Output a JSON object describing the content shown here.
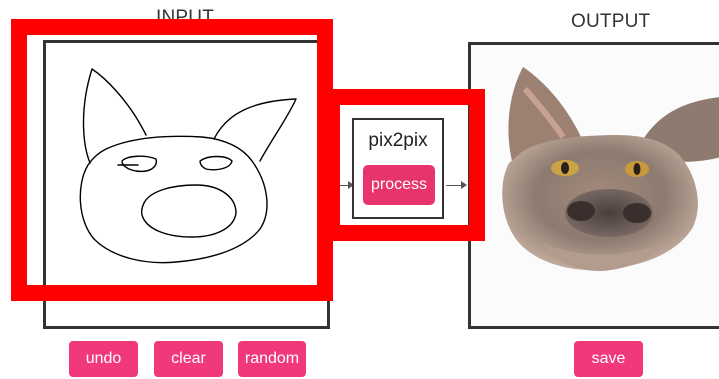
{
  "input": {
    "title": "INPUT",
    "canvas_icon": "pig-sketch-drawing",
    "buttons": {
      "undo": "undo",
      "clear": "clear",
      "random": "random"
    }
  },
  "model": {
    "name": "pix2pix",
    "process_label": "process"
  },
  "output": {
    "title": "OUTPUT",
    "image_icon": "generated-cat-image",
    "save_label": "save"
  },
  "colors": {
    "button": "#f0387a",
    "highlight": "#ff0000",
    "frame": "#333333"
  }
}
